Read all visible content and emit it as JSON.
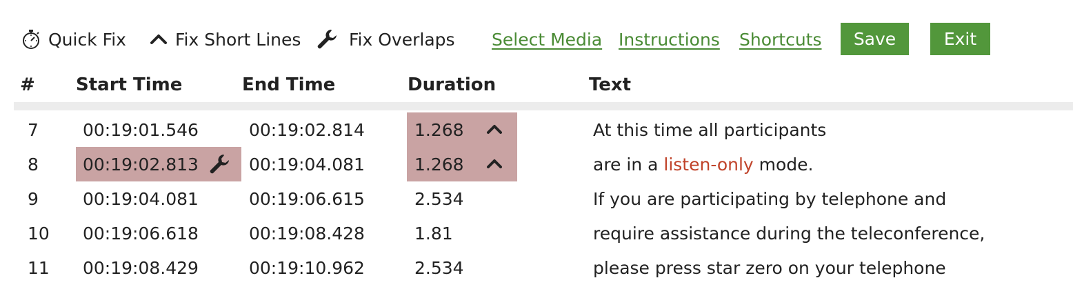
{
  "toolbar": {
    "quick_fix": "Quick Fix",
    "fix_short_lines": "Fix Short Lines",
    "fix_overlaps": "Fix Overlaps",
    "select_media": "Select Media",
    "instructions": "Instructions",
    "shortcuts": "Shortcuts",
    "save": "Save",
    "exit": "Exit"
  },
  "table": {
    "headers": {
      "num": "#",
      "start": "Start Time",
      "end": "End Time",
      "duration": "Duration",
      "text": "Text"
    },
    "rows": [
      {
        "num": "7",
        "start": "00:19:01.546",
        "end": "00:19:02.814",
        "duration": "1.268",
        "text_before": "At this time all participants",
        "text_highlight": "",
        "text_after": ""
      },
      {
        "num": "8",
        "start": "00:19:02.813",
        "end": "00:19:04.081",
        "duration": "1.268",
        "text_before": "are in a ",
        "text_highlight": "listen-only",
        "text_after": " mode."
      },
      {
        "num": "9",
        "start": "00:19:04.081",
        "end": "00:19:06.615",
        "duration": "2.534",
        "text_before": "If you are participating by telephone and",
        "text_highlight": "",
        "text_after": ""
      },
      {
        "num": "10",
        "start": "00:19:06.618",
        "end": "00:19:08.428",
        "duration": "1.81",
        "text_before": "require assistance during the teleconference,",
        "text_highlight": "",
        "text_after": ""
      },
      {
        "num": "11",
        "start": "00:19:08.429",
        "end": "00:19:10.962",
        "duration": "2.534",
        "text_before": "please press star zero on your telephone",
        "text_highlight": "",
        "text_after": ""
      }
    ]
  },
  "icons": {
    "quick_fix": "stopwatch-icon",
    "fix_short_lines": "caret-up-icon",
    "fix_overlaps": "wrench-icon"
  },
  "colors": {
    "link": "#4a8b35",
    "button": "#52973b",
    "warning_highlight": "#c9a3a3",
    "text_highlight": "#c0432a"
  }
}
